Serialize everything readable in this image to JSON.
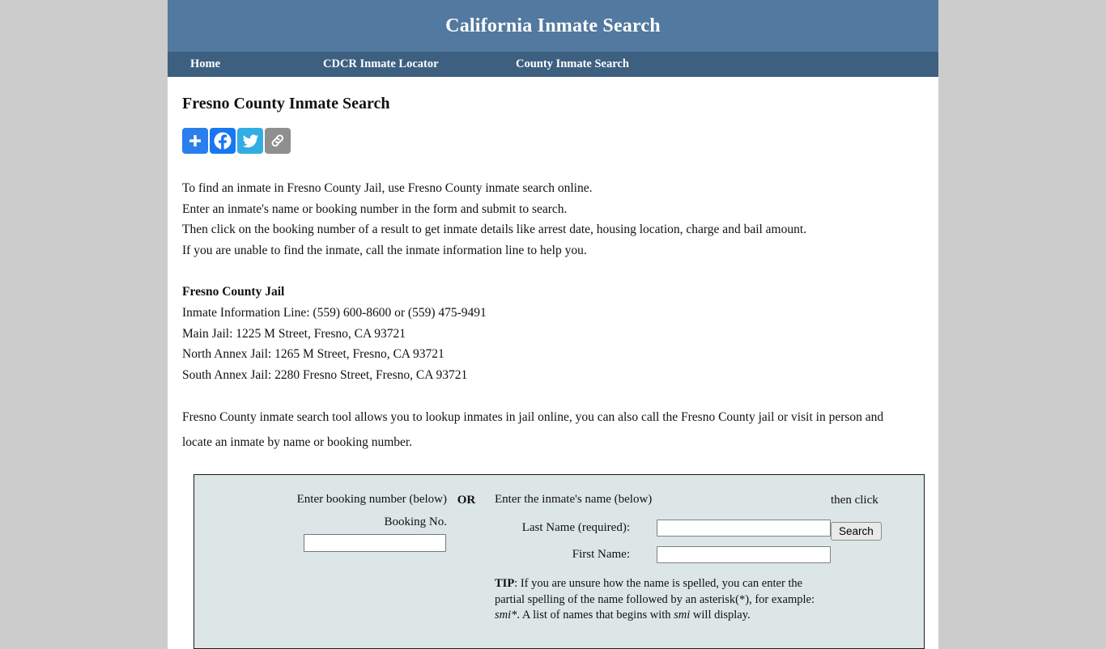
{
  "header": {
    "title": "California Inmate Search",
    "bg_color": "#52799f"
  },
  "nav": {
    "bg_color": "#3d5f80",
    "items": [
      {
        "label": "Home",
        "name": "nav-item-home"
      },
      {
        "label": "CDCR Inmate Locator",
        "name": "nav-item-cdcr-inmate-locator"
      },
      {
        "label": "County Inmate Search",
        "name": "nav-item-county-inmate-search"
      }
    ]
  },
  "main": {
    "page_title": "Fresno County Inmate Search",
    "share": {
      "buttons": [
        {
          "icon": "addthis-plus-icon",
          "label": "Share",
          "color": "#2a7fec"
        },
        {
          "icon": "facebook-icon",
          "label": "Facebook",
          "color": "#1877f2"
        },
        {
          "icon": "twitter-icon",
          "label": "Twitter",
          "color": "#32ade3"
        },
        {
          "icon": "copy-link-icon",
          "label": "Copy Link",
          "color": "#8f8f8f"
        }
      ]
    },
    "intro_lines": [
      "To find an inmate in Fresno County Jail, use Fresno County inmate search online.",
      "Enter an inmate's name or booking number in the form and submit to search.",
      "Then click on the booking number of a result to get inmate details like arrest date, housing location, charge and bail amount.",
      "If you are unable to find the inmate, call the inmate information line to help you."
    ],
    "jail_info": {
      "heading": "Fresno County Jail",
      "lines": [
        "Inmate Information Line: (559) 600-8600 or (559) 475-9491",
        "Main Jail: 1225 M Street, Fresno, CA 93721",
        "North Annex Jail: 1265 M Street, Fresno, CA 93721",
        "South Annex Jail: 2280 Fresno Street, Fresno, CA 93721"
      ]
    },
    "tool_paragraph": "Fresno County inmate search tool allows you to lookup inmates in jail online, you can also call the Fresno County jail or visit in person and locate an inmate by name or booking number."
  },
  "search_form": {
    "bg_color": "#dde6e7",
    "booking_column_heading": "Enter booking number (below)",
    "booking_field_label": "Booking No.",
    "booking_value": "",
    "booking_placeholder": "",
    "or_label": "OR",
    "name_column_heading": "Enter the inmate's name (below)",
    "last_name_label": "Last Name (required):",
    "last_name_value": "",
    "last_name_placeholder": "",
    "first_name_label": "First Name:",
    "first_name_value": "",
    "first_name_placeholder": "",
    "then_click_label": "then click",
    "search_button_label": "Search",
    "tip": {
      "prefix_bold": "TIP",
      "part1": ": If you are unsure how the name is spelled, you can enter the partial spelling of the name followed by an asterisk(*), for example: ",
      "italic1": "smi*",
      "part2": ". A list of names that begins with ",
      "italic2": "smi",
      "part3": " will display."
    }
  }
}
